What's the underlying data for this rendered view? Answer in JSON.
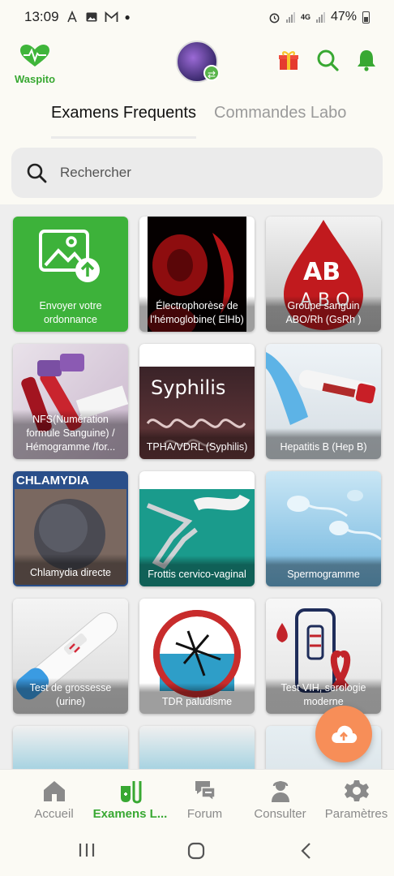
{
  "status": {
    "time": "13:09",
    "battery": "47%",
    "network": "4G"
  },
  "header": {
    "logo_text": "Waspito",
    "accent": "#38a832"
  },
  "tabs": [
    {
      "label": "Examens Frequents",
      "active": true
    },
    {
      "label": "Commandes Labo",
      "active": false
    }
  ],
  "search": {
    "placeholder": "Rechercher"
  },
  "cards": [
    {
      "label": "Envoyer votre ordonnance"
    },
    {
      "label": "Électrophorèse de l'hémoglobine( ElHb)"
    },
    {
      "label": "Groupe sanguin ABO/Rh (GsRh )"
    },
    {
      "label": "NFS(Numération formule Sanguine) / Hémogramme /for..."
    },
    {
      "label": "TPHA/VDRL (Syphilis)",
      "image_text": "Syphilis"
    },
    {
      "label": "Hepatitis B (Hep B)"
    },
    {
      "label": "Chlamydia directe",
      "image_text": "CHLAMYDIA"
    },
    {
      "label": "Frottis cervico-vaginal"
    },
    {
      "label": "Spermogramme"
    },
    {
      "label": "Test de grossesse (urine)"
    },
    {
      "label": "TDR paludisme"
    },
    {
      "label": "Test VIH, serologie moderne"
    }
  ],
  "nav": [
    {
      "label": "Accueil",
      "icon": "home-icon"
    },
    {
      "label": "Examens L...",
      "icon": "lab-tubes-icon",
      "active": true
    },
    {
      "label": "Forum",
      "icon": "chat-icon"
    },
    {
      "label": "Consulter",
      "icon": "doctor-icon"
    },
    {
      "label": "Paramètres",
      "icon": "gear-icon"
    }
  ]
}
